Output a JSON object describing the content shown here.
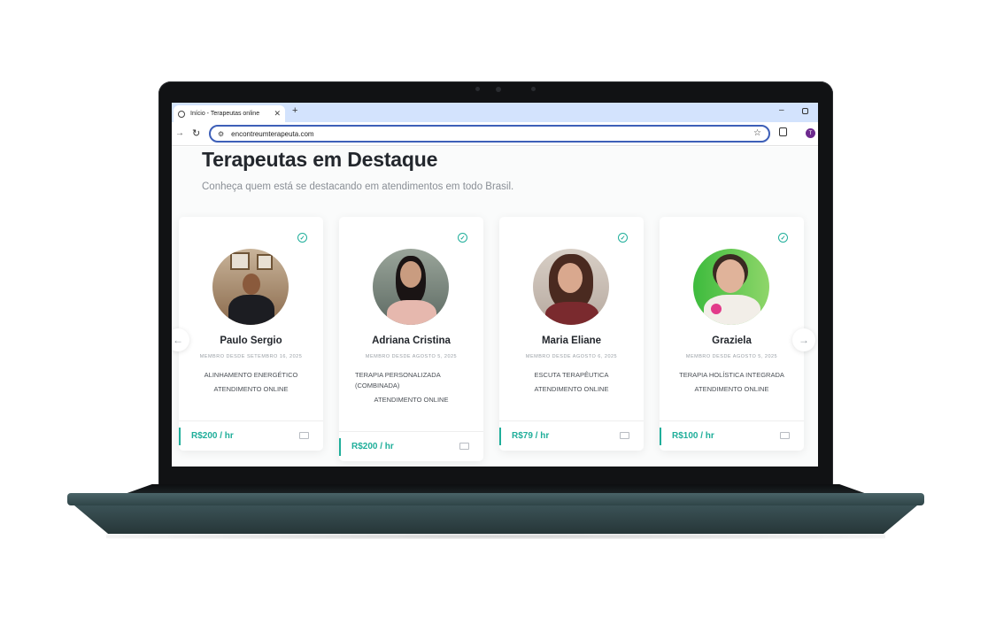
{
  "browser": {
    "tab_title": "Início - Terapeutas online",
    "url": "encontreumterapeuta.com",
    "profile_initial": "T"
  },
  "page": {
    "title": "Terapeutas em Destaque",
    "subtitle": "Conheça quem está se destacando em atendimentos em todo Brasil."
  },
  "therapists": [
    {
      "name": "Paulo Sergio",
      "member_since": "MEMBRO DESDE SETEMBRO 16, 2025",
      "specialty": "ALINHAMENTO ENERGÉTICO",
      "mode": "ATENDIMENTO ONLINE",
      "price": "R$200 / hr"
    },
    {
      "name": "Adriana Cristina",
      "member_since": "MEMBRO DESDE AGOSTO 5, 2025",
      "specialty": "TERAPIA PERSONALIZADA (COMBINADA)",
      "mode": "ATENDIMENTO ONLINE",
      "price": "R$200 / hr"
    },
    {
      "name": "Maria Eliane",
      "member_since": "MEMBRO DESDE AGOSTO 6, 2025",
      "specialty": "ESCUTA TERAPÊUTICA",
      "mode": "ATENDIMENTO ONLINE",
      "price": "R$79 / hr"
    },
    {
      "name": "Graziela",
      "member_since": "MEMBRO DESDE AGOSTO 5, 2025",
      "specialty": "TERAPIA HOLÍSTICA INTEGRADA",
      "mode": "ATENDIMENTO ONLINE",
      "price": "R$100 / hr"
    }
  ],
  "colors": {
    "accent": "#1fae9a",
    "heading": "#23272d",
    "chrome_tabbar": "#d3e3fd"
  },
  "icons": {
    "verified": "check-circle-icon",
    "chat": "message-icon",
    "prev": "arrow-left-icon",
    "next": "arrow-right-icon"
  }
}
